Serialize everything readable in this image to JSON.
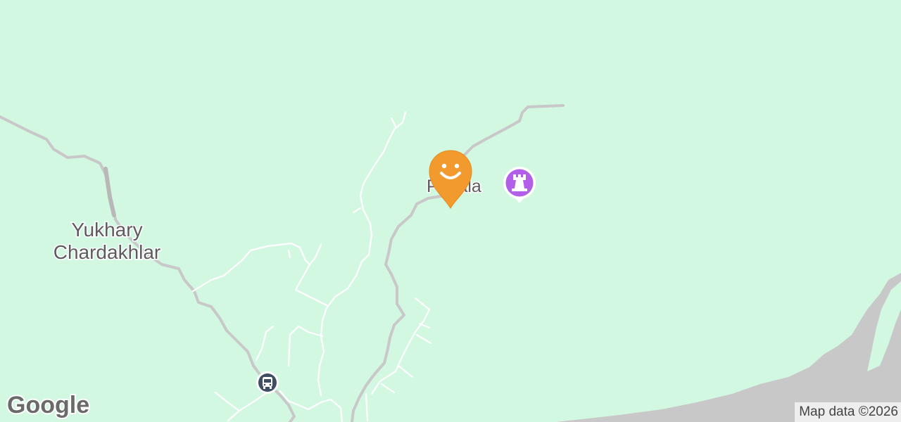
{
  "map": {
    "labels": {
      "yukhary_line1": "Yukhary",
      "yukhary_line2": "Chardakhlar",
      "pirgala": "Pirgala"
    },
    "attribution": "Map data ©2026",
    "logo_text": "Google",
    "markers": {
      "favorite": "smiley-icon",
      "landmark": "castle-icon",
      "transit": "bus-icon"
    },
    "colors": {
      "land": "#d3f8e2",
      "water": "#c8c8c8",
      "road": "#c8c8c8",
      "minor_road": "#ffffff",
      "favorite_marker": "#f29a2e",
      "landmark_marker": "#b15ee8",
      "transit_marker": "#3e4f63"
    }
  }
}
